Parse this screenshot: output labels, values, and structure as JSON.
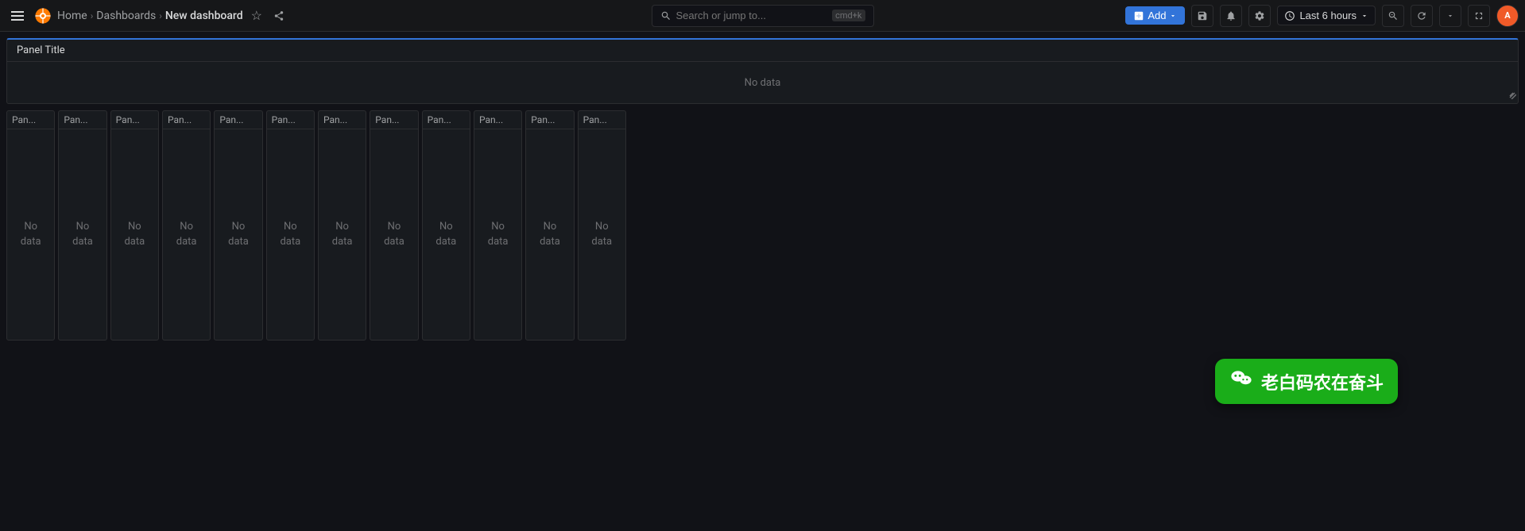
{
  "app": {
    "title": "New dashboard - Dashboards - Grafana"
  },
  "topbar": {
    "logo_label": "Grafana",
    "home_label": "Home",
    "dashboards_label": "Dashboards",
    "current_page": "New dashboard",
    "search_placeholder": "Search or jump to...",
    "search_shortcut": "cmd+k",
    "add_label": "Add",
    "time_range_label": "Last 6 hours",
    "zoom_out_label": "⊖",
    "refresh_label": "↺",
    "settings_label": "⚙",
    "save_label": "💾",
    "alerts_label": "🔔",
    "profile_label": "👤"
  },
  "panel_large": {
    "title": "Panel Title",
    "no_data": "No data"
  },
  "panels": [
    {
      "title": "Pan...",
      "no_data": "No\ndata"
    },
    {
      "title": "Pan...",
      "no_data": "No\ndata"
    },
    {
      "title": "Pan...",
      "no_data": "No\ndata"
    },
    {
      "title": "Pan...",
      "no_data": "No\ndata"
    },
    {
      "title": "Pan...",
      "no_data": "No\ndata"
    },
    {
      "title": "Pan...",
      "no_data": "No\ndata"
    },
    {
      "title": "Pan...",
      "no_data": "No\ndata"
    },
    {
      "title": "Pan...",
      "no_data": "No\ndata"
    },
    {
      "title": "Pan...",
      "no_data": "No\ndata"
    },
    {
      "title": "Pan...",
      "no_data": "No\ndata"
    },
    {
      "title": "Pan...",
      "no_data": "No\ndata"
    },
    {
      "title": "Pan...",
      "no_data": "No\ndata"
    }
  ],
  "wechat": {
    "text": "老白码农在奋斗"
  }
}
